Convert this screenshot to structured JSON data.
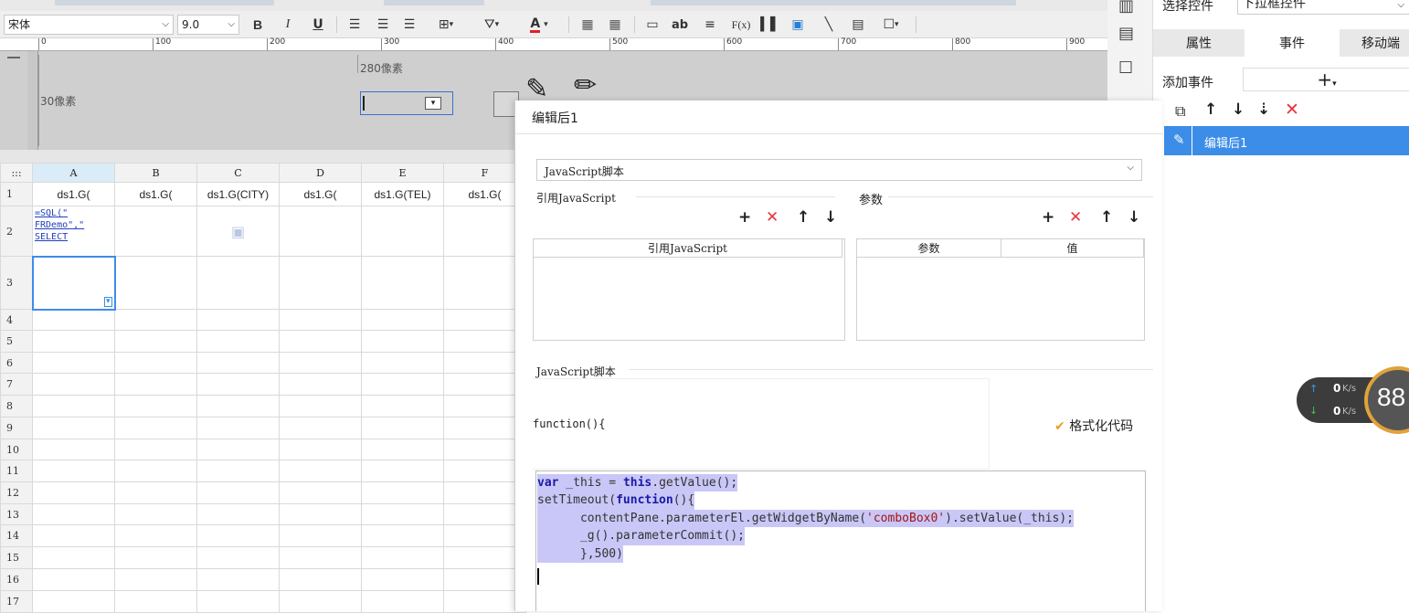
{
  "toolbar": {
    "font_name": "宋体",
    "font_size": "9.0",
    "bold": "B",
    "italic": "I",
    "underline": "U",
    "font_color_letter": "A",
    "text_icon": "ab",
    "formula_icon": "F(x)"
  },
  "ruler": {
    "marks": [
      "0",
      "100",
      "200",
      "300",
      "400",
      "500",
      "600",
      "700",
      "800",
      "900"
    ]
  },
  "param_pane": {
    "width_label": "280像素",
    "height_label": "30像素"
  },
  "sheet": {
    "corner": ":::",
    "columns": [
      "A",
      "B",
      "C",
      "D",
      "E",
      "F"
    ],
    "rows": [
      "1",
      "2",
      "3",
      "4",
      "5",
      "6",
      "7",
      "8",
      "9",
      "10",
      "11",
      "12",
      "13",
      "14",
      "15",
      "16",
      "17"
    ],
    "row1": [
      "ds1.G(",
      "ds1.G(",
      "ds1.G(CITY)",
      "ds1.G(",
      "ds1.G(TEL)",
      "ds1.G("
    ],
    "a2_line1": "=SQL(\"",
    "a2_line2": "FRDemo\",\"",
    "a2_line3": "SELECT"
  },
  "right_panel": {
    "select_widget_label": "选择控件",
    "select_widget_value": "下拉框控件",
    "tabs": [
      "属性",
      "事件",
      "移动端"
    ],
    "add_event_label": "添加事件",
    "add_event_btn": "+",
    "event_item": "编辑后1"
  },
  "dialog": {
    "title": "编辑后1",
    "type_select": "JavaScript脚本",
    "ref_js_label": "引用JavaScript",
    "params_label": "参数",
    "ref_js_col": "引用JavaScript",
    "param_col": "参数",
    "value_col": "值",
    "js_script_label": "JavaScript脚本",
    "function_header": "function(){",
    "format_code": "格式化代码",
    "code_lines": [
      [
        {
          "t": "var",
          "c": "kw"
        },
        {
          "t": " _this = ",
          "c": "pn"
        },
        {
          "t": "this",
          "c": "kw"
        },
        {
          "t": ".getValue();",
          "c": "pn"
        }
      ],
      [
        {
          "t": "setTimeout(",
          "c": "pn"
        },
        {
          "t": "function",
          "c": "kw"
        },
        {
          "t": "(){",
          "c": "pn"
        }
      ],
      [
        {
          "t": "      contentPane.parameterEl.getWidgetByName(",
          "c": "pn"
        },
        {
          "t": "'comboBox0'",
          "c": "str"
        },
        {
          "t": ").setValue(_this);",
          "c": "pn"
        }
      ],
      [
        {
          "t": "      _g().parameterCommit();",
          "c": "pn"
        }
      ],
      [
        {
          "t": "      },500)",
          "c": "pn"
        }
      ]
    ]
  },
  "speed_widget": {
    "up": "0",
    "down": "0",
    "unit": "K/s",
    "percent": "88"
  },
  "colors": {
    "selection_blue": "#3c8de8",
    "delete_red": "#e8353b",
    "code_highlight": "#c9c7f7"
  }
}
